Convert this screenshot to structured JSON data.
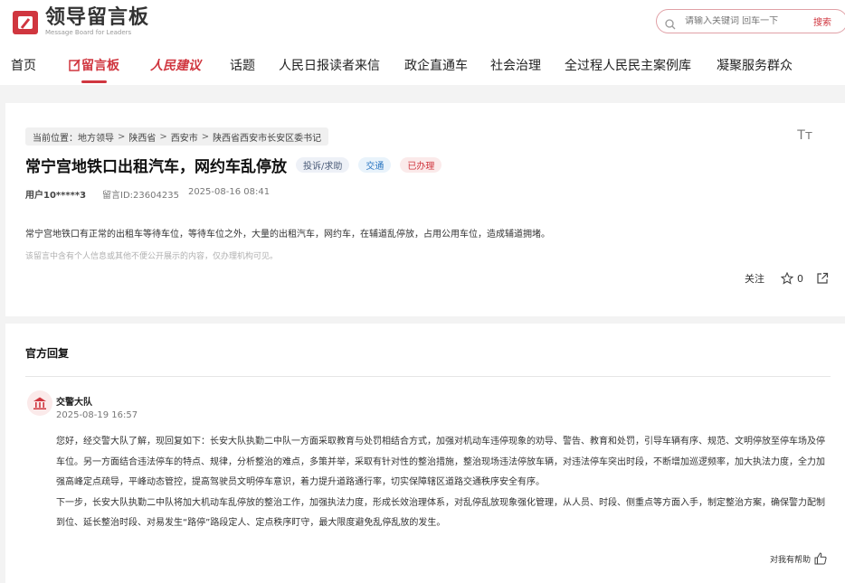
{
  "header": {
    "logo_title": "领导留言板",
    "logo_subtitle": "Message Board for Leaders",
    "search_placeholder": "请输入关键词 回车一下",
    "search_button": "搜索",
    "brand_color": "#d0363f"
  },
  "nav": {
    "home": "首页",
    "board": "留言板",
    "renmin": "人民建议",
    "topics": "话题",
    "letters": "人民日报读者来信",
    "zhengqi": "政企直通车",
    "governance": "社会治理",
    "democracy": "全过程人民民主案例库",
    "service": "凝聚服务群众"
  },
  "message": {
    "breadcrumb_label": "当前位置：",
    "breadcrumb": [
      "地方领导",
      "陕西省",
      "西安市",
      "陕西省西安市长安区委书记"
    ],
    "font_toggle": "Tт",
    "title": "常宁宫地铁口出租汽车，网约车乱停放",
    "tags": {
      "type": "投诉/求助",
      "domain": "交通",
      "status": "已办理"
    },
    "user": "用户10*****3",
    "message_id": "留言ID:23604235",
    "time": "2025-08-16 08:41",
    "content": "常宁宫地铁口有正常的出租车等待车位，等待车位之外，大量的出租汽车，网约车，在辅道乱停放，占用公用车位，造成辅道拥堵。",
    "privacy_note": "该留言中含有个人信息或其他不便公开展示的内容，仅办理机构可见。",
    "follow_label": "关注",
    "star_count": "0"
  },
  "reply": {
    "heading": "官方回复",
    "org": "交警大队",
    "time": "2025-08-19 16:57",
    "para1": "您好，经交警大队了解，现回复如下：长安大队执勤二中队一方面采取教育与处罚相结合方式，加强对机动车违停现象的劝导、警告、教育和处罚，引导车辆有序、规范、文明停放至停车场及停车位。另一方面结合违法停车的特点、规律，分析整治的难点，多策并举，采取有针对性的整治措施，整治现场违法停放车辆，对违法停车突出时段，不断增加巡逻频率，加大执法力度，全力加强高峰定点疏导，平峰动态管控，提高驾驶员文明停车意识，着力提升道路通行率，切实保障辖区道路交通秩序安全有序。",
    "para2": "下一步，长安大队执勤二中队将加大机动车乱停放的整治工作，加强执法力度，形成长效治理体系，对乱停乱放现象强化管理，从人员、时段、侧重点等方面入手，制定整治方案，确保警力配制到位、延长整治时段、对易发生“路停”路段定人、定点秩序盯守，最大限度避免乱停乱放的发生。",
    "helpful_label": "对我有帮助"
  }
}
